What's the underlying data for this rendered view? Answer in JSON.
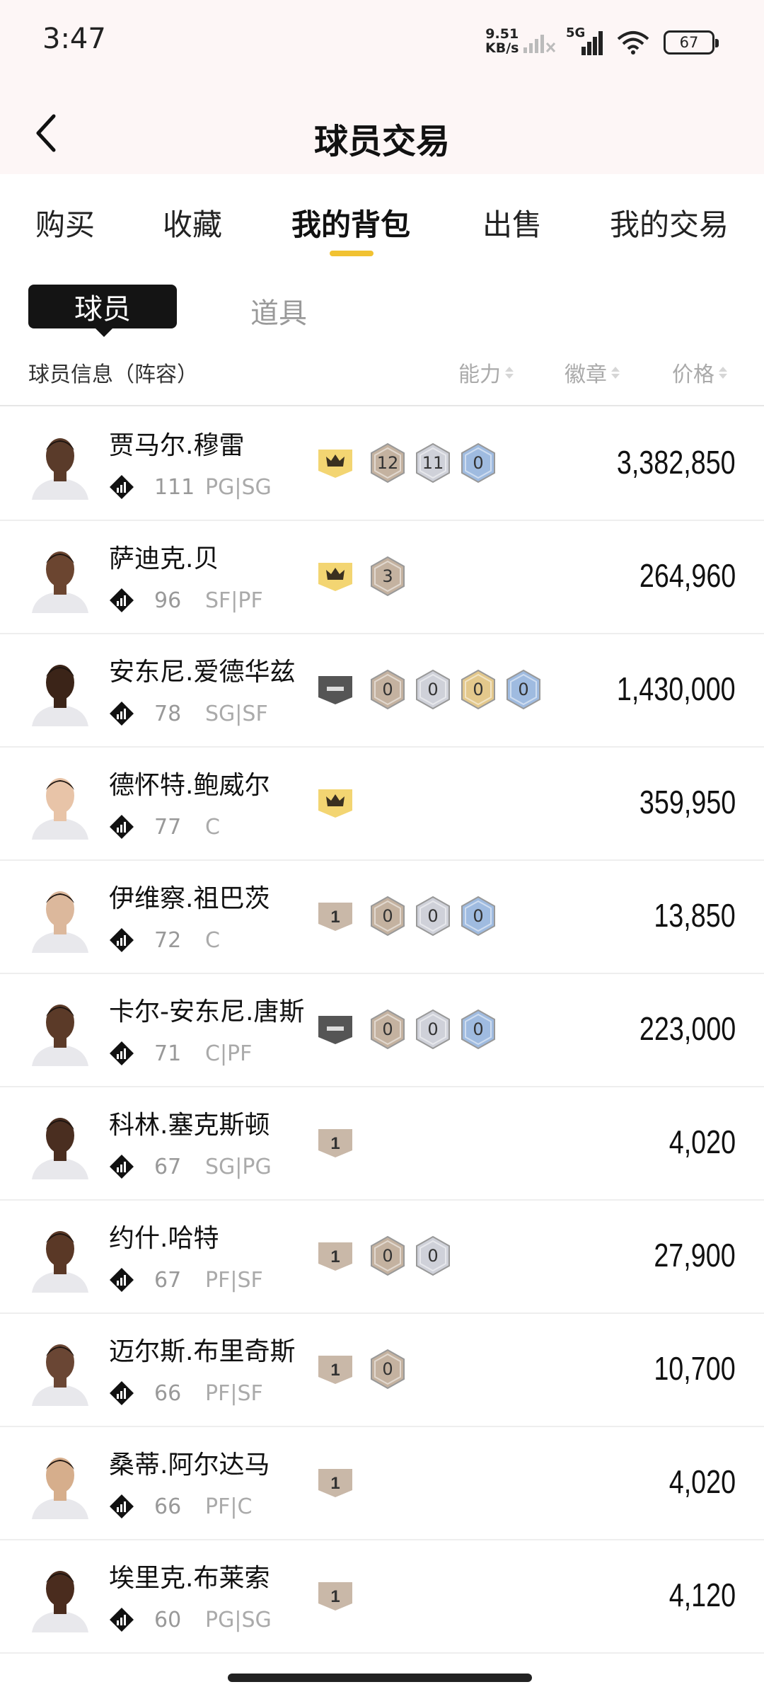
{
  "status_bar": {
    "time": "3:47",
    "net_speed_value": "9.51",
    "net_speed_unit": "KB/s",
    "network": "5G",
    "battery": "67"
  },
  "header": {
    "title": "球员交易"
  },
  "tabs": [
    {
      "label": "购买"
    },
    {
      "label": "收藏"
    },
    {
      "label": "我的背包",
      "active": true
    },
    {
      "label": "出售"
    },
    {
      "label": "我的交易"
    }
  ],
  "subtabs": {
    "active": "球员",
    "inactive": "道具"
  },
  "columns": {
    "info": "球员信息（阵容）",
    "ability": "能力",
    "badges": "徽章",
    "price": "价格"
  },
  "colors": {
    "accent": "#f1c232",
    "gold_tier": "#f3d572",
    "dark_tier": "#555555",
    "bronze_tier": "#c9b8a8",
    "badge_bronze": "#c4b2a0",
    "badge_silver": "#cfd1d9",
    "badge_gold": "#e3c88c",
    "badge_blue": "#9fbbe0"
  },
  "players": [
    {
      "name": "贾马尔.穆雷",
      "ovr": "111",
      "pos": "PG|SG",
      "tier": "crown",
      "badges": [
        {
          "n": "12",
          "c": "bronze"
        },
        {
          "n": "11",
          "c": "silver"
        },
        {
          "n": "0",
          "c": "blue"
        }
      ],
      "price": "3,382,850",
      "skin": "#5a3b2a"
    },
    {
      "name": "萨迪克.贝",
      "ovr": "96",
      "pos": "SF|PF",
      "tier": "crown",
      "badges": [
        {
          "n": "3",
          "c": "bronze"
        }
      ],
      "price": "264,960",
      "skin": "#6b4530"
    },
    {
      "name": "安东尼.爱德华兹",
      "ovr": "78",
      "pos": "SG|SF",
      "tier": "dash",
      "badges": [
        {
          "n": "0",
          "c": "bronze"
        },
        {
          "n": "0",
          "c": "silver"
        },
        {
          "n": "0",
          "c": "gold"
        },
        {
          "n": "0",
          "c": "blue"
        }
      ],
      "price": "1,430,000",
      "skin": "#3b2418"
    },
    {
      "name": "德怀特.鲍威尔",
      "ovr": "77",
      "pos": "C",
      "tier": "crown",
      "badges": [],
      "price": "359,950",
      "skin": "#e8c4a8"
    },
    {
      "name": "伊维察.祖巴茨",
      "ovr": "72",
      "pos": "C",
      "tier": "one",
      "badges": [
        {
          "n": "0",
          "c": "bronze"
        },
        {
          "n": "0",
          "c": "silver"
        },
        {
          "n": "0",
          "c": "blue"
        }
      ],
      "price": "13,850",
      "skin": "#dcb89c"
    },
    {
      "name": "卡尔-安东尼.唐斯",
      "ovr": "71",
      "pos": "C|PF",
      "tier": "dash",
      "badges": [
        {
          "n": "0",
          "c": "bronze"
        },
        {
          "n": "0",
          "c": "silver"
        },
        {
          "n": "0",
          "c": "blue"
        }
      ],
      "price": "223,000",
      "skin": "#5b3a28"
    },
    {
      "name": "科林.塞克斯顿",
      "ovr": "67",
      "pos": "SG|PG",
      "tier": "one",
      "badges": [],
      "price": "4,020",
      "skin": "#4a2e20"
    },
    {
      "name": "约什.哈特",
      "ovr": "67",
      "pos": "PF|SF",
      "tier": "one",
      "badges": [
        {
          "n": "0",
          "c": "bronze"
        },
        {
          "n": "0",
          "c": "silver"
        }
      ],
      "price": "27,900",
      "skin": "#5a3826"
    },
    {
      "name": "迈尔斯.布里奇斯",
      "ovr": "66",
      "pos": "PF|SF",
      "tier": "one",
      "badges": [
        {
          "n": "0",
          "c": "bronze"
        }
      ],
      "price": "10,700",
      "skin": "#6a4634"
    },
    {
      "name": "桑蒂.阿尔达马",
      "ovr": "66",
      "pos": "PF|C",
      "tier": "one",
      "badges": [],
      "price": "4,020",
      "skin": "#d6ae8c"
    },
    {
      "name": "埃里克.布莱索",
      "ovr": "60",
      "pos": "PG|SG",
      "tier": "one",
      "badges": [],
      "price": "4,120",
      "skin": "#4a2c1e"
    }
  ]
}
